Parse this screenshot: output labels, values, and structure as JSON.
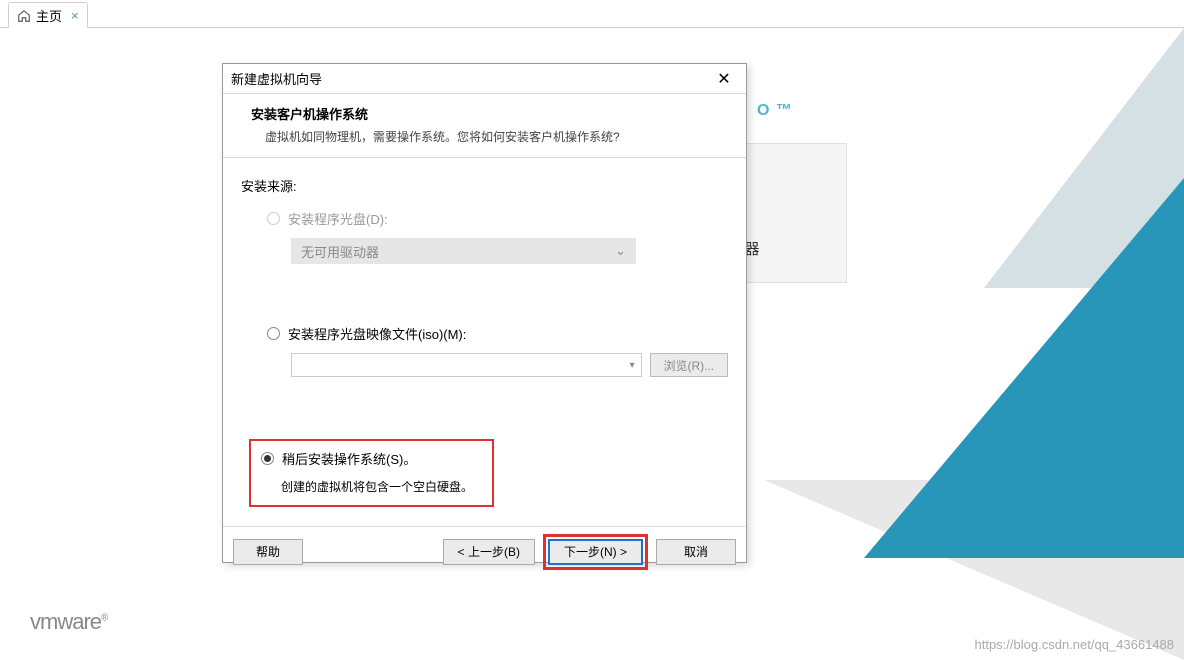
{
  "tab": {
    "label": "主页"
  },
  "background": {
    "pro_suffix": "O ™",
    "card": {
      "label": "连接远程服务器"
    },
    "logo": "vmware",
    "watermark": "https://blog.csdn.net/qq_43661488"
  },
  "dialog": {
    "title": "新建虚拟机向导",
    "heading": "安装客户机操作系统",
    "subheading": "虚拟机如同物理机，需要操作系统。您将如何安装客户机操作系统?",
    "source_label": "安装来源:",
    "option_disc": {
      "label": "安装程序光盘(D):",
      "dropdown": "无可用驱动器"
    },
    "option_iso": {
      "label": "安装程序光盘映像文件(iso)(M):",
      "browse": "浏览(R)..."
    },
    "option_later": {
      "label": "稍后安装操作系统(S)。",
      "sub": "创建的虚拟机将包含一个空白硬盘。"
    },
    "buttons": {
      "help": "帮助",
      "back": "< 上一步(B)",
      "next": "下一步(N) >",
      "cancel": "取消"
    }
  }
}
